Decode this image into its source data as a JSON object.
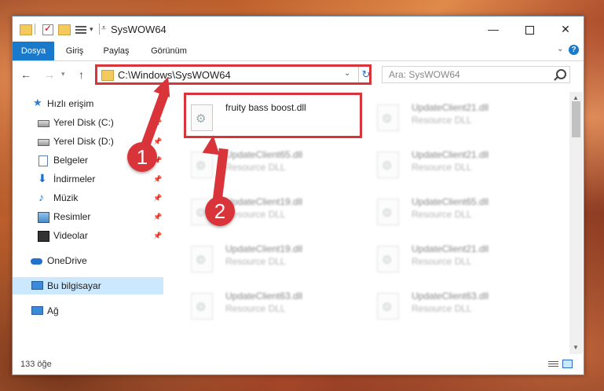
{
  "window": {
    "title": "SysWOW64"
  },
  "ribbon": {
    "tabs": [
      "Dosya",
      "Giriş",
      "Paylaş",
      "Görünüm"
    ]
  },
  "address": {
    "path": "C:\\Windows\\SysWOW64"
  },
  "search": {
    "placeholder": "Ara: SysWOW64"
  },
  "sidebar": {
    "items": [
      {
        "label": "Hızlı erişim",
        "icon": "star-icon"
      },
      {
        "label": "Yerel Disk (C:)",
        "icon": "drive-icon"
      },
      {
        "label": "Yerel Disk (D:)",
        "icon": "drive-icon"
      },
      {
        "label": "Belgeler",
        "icon": "documents-icon"
      },
      {
        "label": "İndirmeler",
        "icon": "download-icon"
      },
      {
        "label": "Müzik",
        "icon": "music-icon"
      },
      {
        "label": "Resimler",
        "icon": "pictures-icon"
      },
      {
        "label": "Videolar",
        "icon": "videos-icon"
      },
      {
        "label": "OneDrive",
        "icon": "cloud-icon"
      },
      {
        "label": "Bu bilgisayar",
        "icon": "computer-icon"
      },
      {
        "label": "Ağ",
        "icon": "network-icon"
      }
    ]
  },
  "files": [
    {
      "name": "fruity bass boost.dll",
      "type": ""
    },
    {
      "name": "UpdateClient21.dll",
      "type": "Resource DLL"
    },
    {
      "name": "UpdateClient65.dll",
      "type": "Resource DLL"
    },
    {
      "name": "UpdateClient21.dll",
      "type": "Resource DLL"
    },
    {
      "name": "UpdateClient19.dll",
      "type": "Resource DLL"
    },
    {
      "name": "UpdateClient65.dll",
      "type": "Resource DLL"
    },
    {
      "name": "UpdateClient19.dll",
      "type": "Resource DLL"
    },
    {
      "name": "UpdateClient21.dll",
      "type": "Resource DLL"
    },
    {
      "name": "UpdateClient63.dll",
      "type": "Resource DLL"
    },
    {
      "name": "UpdateClient63.dll",
      "type": "Resource DLL"
    }
  ],
  "status": {
    "count": "133 öğe"
  },
  "annotations": {
    "step1": "1",
    "step2": "2",
    "color": "#d9343a"
  }
}
